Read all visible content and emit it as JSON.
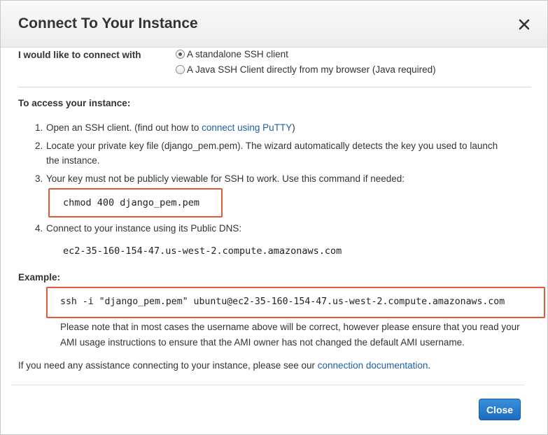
{
  "dialog": {
    "title": "Connect To Your Instance",
    "close_icon": "close-icon"
  },
  "connect_with": {
    "label": "I would like to connect with",
    "options": [
      {
        "label": "A standalone SSH client",
        "selected": true
      },
      {
        "label": "A Java SSH Client directly from my browser (Java required)",
        "selected": false
      }
    ]
  },
  "access": {
    "heading": "To access your instance:",
    "steps": [
      {
        "num": "1.",
        "before": "Open an SSH client. (find out how to ",
        "link": "connect using PuTTY",
        "after": ")"
      },
      {
        "num": "2.",
        "line1": "Locate your private key file (django_pem.pem). The wizard automatically detects the key you used to launch",
        "line2": "the instance."
      },
      {
        "num": "3.",
        "text": "Your key must not be publicly viewable for SSH to work. Use this command if needed:"
      },
      {
        "num": "4.",
        "text": "Connect to your instance using its Public DNS:"
      }
    ],
    "chmod_command": "chmod 400 django_pem.pem",
    "public_dns": "ec2-35-160-154-47.us-west-2.compute.amazonaws.com"
  },
  "example": {
    "heading": "Example:",
    "ssh_command": "ssh -i \"django_pem.pem\" ubuntu@ec2-35-160-154-47.us-west-2.compute.amazonaws.com",
    "note": "Please note that in most cases the username above will be correct, however please ensure that you read your AMI usage instructions to ensure that the AMI owner has not changed the default AMI username."
  },
  "assistance": {
    "before": "If you need any assistance connecting to your instance, please see our ",
    "link": "connection documentation",
    "after": "."
  },
  "footer": {
    "close_label": "Close"
  },
  "colors": {
    "highlight_border": "#e3573a",
    "link": "#1f5fa8",
    "primary_button": "#1c6dc0"
  }
}
